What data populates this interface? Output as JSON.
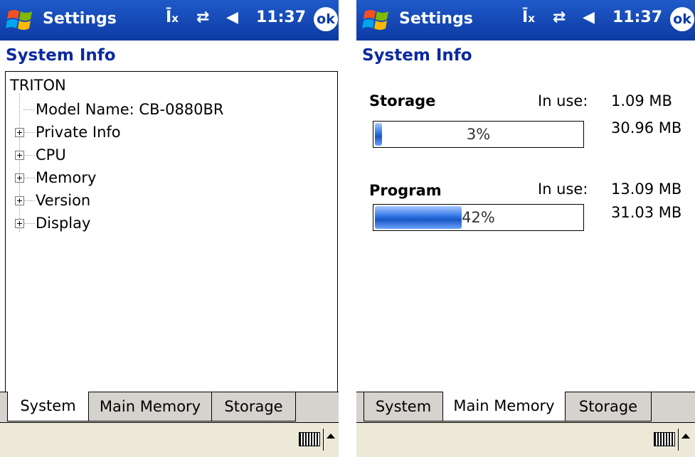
{
  "colors": {
    "titlebar": "#1f5ac9",
    "heading": "#0b2aa0",
    "bar_fill": "#2f75e6"
  },
  "left": {
    "titlebar": {
      "title": "Settings",
      "time": "11:37",
      "ok_label": "ok"
    },
    "heading": "System Info",
    "tree": {
      "root": "TRITON",
      "items": [
        "Model Name: CB-0880BR",
        "Private Info",
        "CPU",
        "Memory",
        "Version",
        "Display"
      ]
    },
    "tabs": [
      "System",
      "Main Memory",
      "Storage"
    ],
    "active_tab": "System"
  },
  "right": {
    "titlebar": {
      "title": "Settings",
      "time": "11:37",
      "ok_label": "ok"
    },
    "heading": "System Info",
    "storage": {
      "label": "Storage",
      "in_use_label": "In use:",
      "in_use_value": "1.09 MB",
      "total": "30.96 MB",
      "percent_text": "3%",
      "percent": 3
    },
    "program": {
      "label": "Program",
      "in_use_label": "In use:",
      "in_use_value": "13.09 MB",
      "total": "31.03 MB",
      "percent_text": "42%",
      "percent": 42
    },
    "tabs": [
      "System",
      "Main Memory",
      "Storage"
    ],
    "active_tab": "Main Memory"
  }
}
